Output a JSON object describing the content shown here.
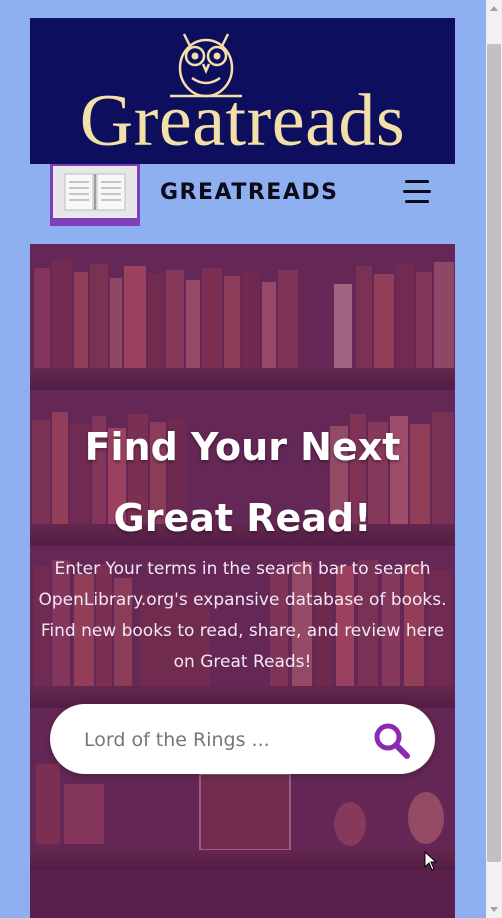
{
  "banner": {
    "wordmark": "Greatreads"
  },
  "navbar": {
    "brand": "GREATREADS",
    "menu_icon": "hamburger-menu-icon",
    "logo_icon": "open-book-icon"
  },
  "hero": {
    "headline_line1": "Find Your Next",
    "headline_line2": "Great Read!",
    "intro": "Enter Your terms in the search bar to search OpenLibrary.org's expansive database of books. Find new books to read, share, and review here on Great Reads!"
  },
  "search": {
    "placeholder": "Lord of the Rings ...",
    "button_icon": "search-icon"
  },
  "colors": {
    "page_bg": "#8fb0f0",
    "banner_bg": "#0d0f5e",
    "wordmark": "#f3dfa8",
    "accent_purple": "#7e3fb8",
    "hero_overlay": "#782d6e"
  }
}
